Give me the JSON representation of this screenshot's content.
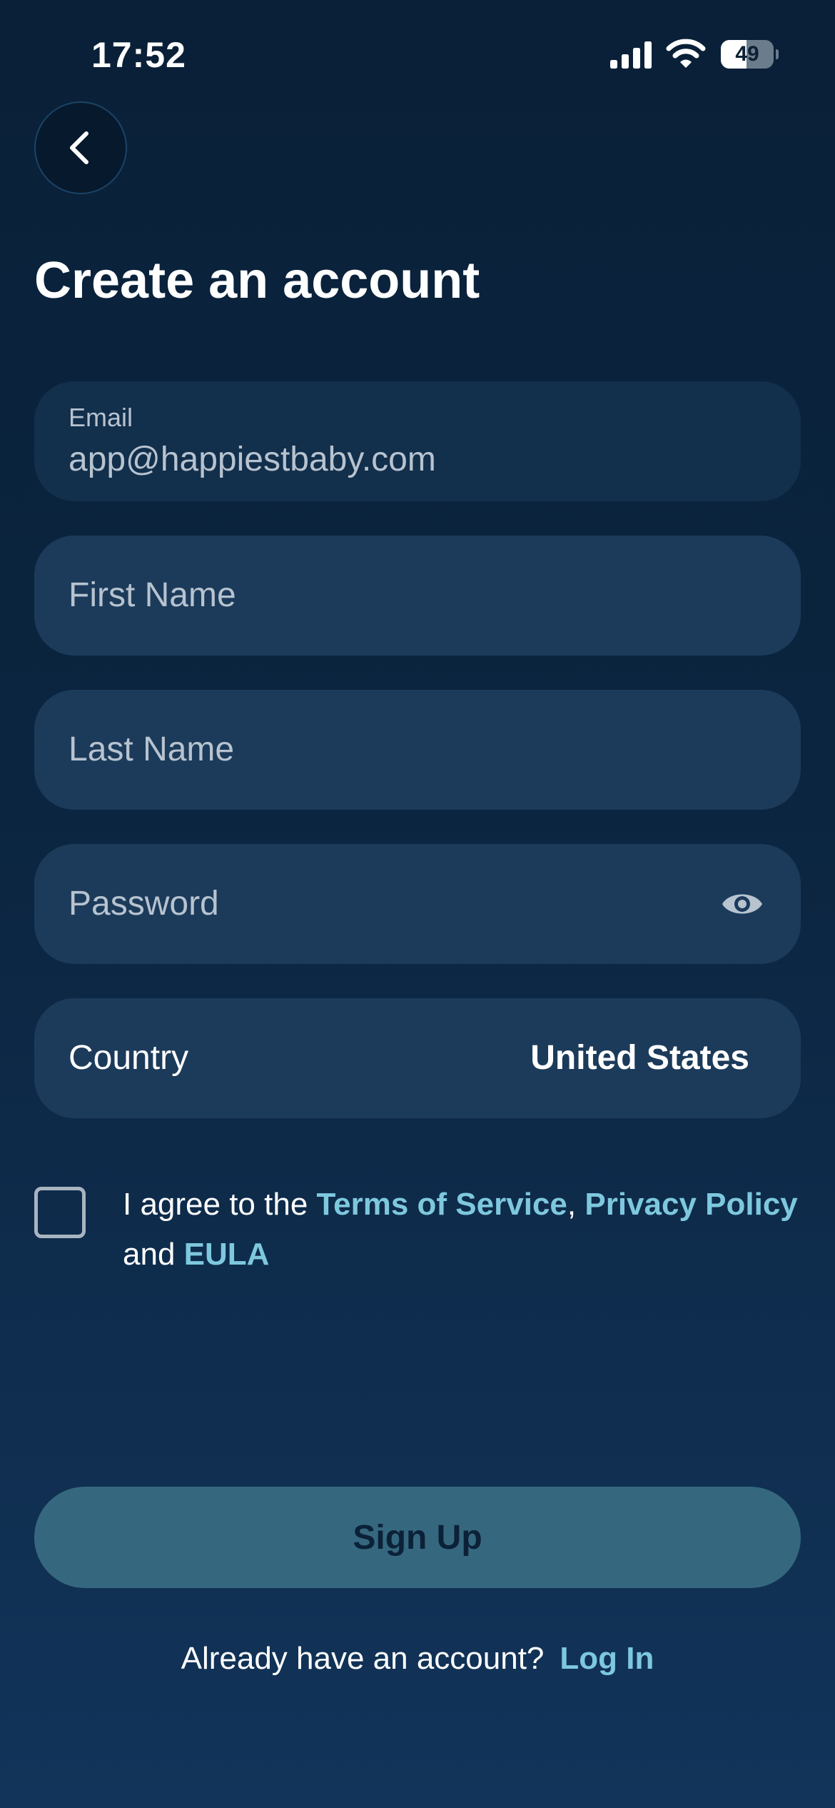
{
  "status_bar": {
    "time": "17:52",
    "battery_level": "49",
    "battery_fraction": 0.49,
    "signal_icon": "cellular-signal-icon",
    "wifi_icon": "wifi-icon"
  },
  "header": {
    "back_icon": "chevron-left-icon",
    "title": "Create an account"
  },
  "form": {
    "email": {
      "label": "Email",
      "value": "app@happiestbaby.com"
    },
    "first_name": {
      "placeholder": "First Name"
    },
    "last_name": {
      "placeholder": "Last Name"
    },
    "password": {
      "placeholder": "Password",
      "toggle_icon": "eye-icon"
    },
    "country": {
      "label": "Country",
      "value": "United States"
    }
  },
  "agreement": {
    "prefix": "I agree to the ",
    "terms": "Terms of Service",
    "separator": ", ",
    "privacy": "Privacy Policy",
    "conjunction": " and ",
    "eula": "EULA",
    "checked": false
  },
  "actions": {
    "signup_label": "Sign Up",
    "login_prompt": "Already have an account?",
    "login_link": "Log In"
  },
  "colors": {
    "background_top": "#0a2038",
    "background_bottom": "#12345a",
    "field": "#1c3b5b",
    "email_field": "#122f4c",
    "link": "#7ec8de",
    "signup_button": "#35687f",
    "signup_text": "#0c2138"
  }
}
